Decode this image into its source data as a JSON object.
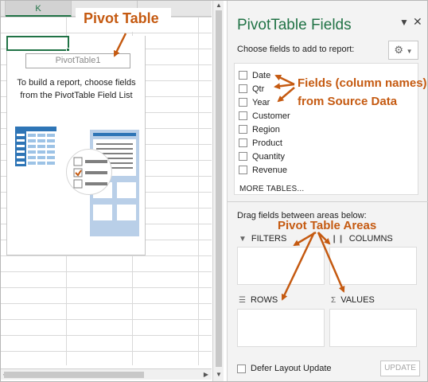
{
  "sheet": {
    "column_headers": [
      "",
      "K",
      ""
    ],
    "active_column": "K",
    "pivot_name": "PivotTable1",
    "instruction": "To build a report, choose fields from the PivotTable Field List"
  },
  "pane": {
    "title": "PivotTable Fields",
    "dropdown_icon": "chevron-down-icon",
    "close_icon": "close-icon",
    "choose_label": "Choose fields to add to report:",
    "settings_icon": "gear-icon",
    "fields": [
      {
        "label": "Date",
        "checked": false
      },
      {
        "label": "Qtr",
        "checked": false
      },
      {
        "label": "Year",
        "checked": false
      },
      {
        "label": "Customer",
        "checked": false
      },
      {
        "label": "Region",
        "checked": false
      },
      {
        "label": "Product",
        "checked": false
      },
      {
        "label": "Quantity",
        "checked": false
      },
      {
        "label": "Revenue",
        "checked": false
      }
    ],
    "more_tables": "MORE TABLES...",
    "drag_label": "Drag fields between areas below:",
    "areas": {
      "filters": "FILTERS",
      "columns": "COLUMNS",
      "rows": "ROWS",
      "values": "VALUES"
    },
    "defer_label": "Defer Layout Update",
    "update_label": "UPDATE"
  },
  "annotations": {
    "pivot_table": "Pivot Table",
    "fields_line1": "Fields (column names)",
    "fields_line2": "from Source Data",
    "areas": "Pivot Table Areas"
  },
  "colors": {
    "excel_green": "#217346",
    "annotation_orange": "#c55a11",
    "illustration_blue": "#b9cfe8",
    "illustration_dark_blue": "#2e75b6"
  }
}
